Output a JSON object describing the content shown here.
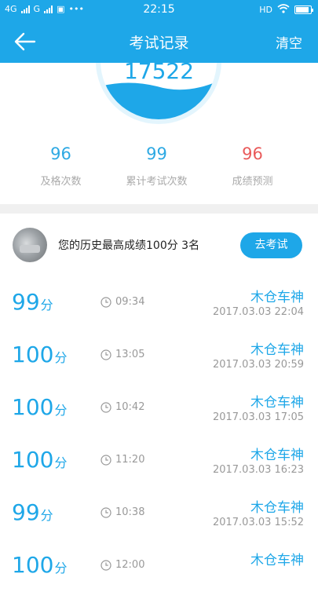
{
  "status_bar": {
    "left_text_1": "4G",
    "left_text_2": "G",
    "dots": "•••",
    "time": "22:15",
    "hd": "HD"
  },
  "app_bar": {
    "title": "考试记录",
    "clear_label": "清空"
  },
  "summary": {
    "total_score": "17522",
    "stats": [
      {
        "value": "96",
        "label": "及格次数"
      },
      {
        "value": "99",
        "label": "累计考试次数"
      },
      {
        "value": "96",
        "label": "成绩预测"
      }
    ]
  },
  "history": {
    "best_text": "您的历史最高成绩100分  3名",
    "button_label": "去考试"
  },
  "records": [
    {
      "score": "99",
      "unit": "分",
      "duration": "09:34",
      "user": "木仓车神",
      "datetime": "2017.03.03   22:04"
    },
    {
      "score": "100",
      "unit": "分",
      "duration": "13:05",
      "user": "木仓车神",
      "datetime": "2017.03.03   20:59"
    },
    {
      "score": "100",
      "unit": "分",
      "duration": "10:42",
      "user": "木仓车神",
      "datetime": "2017.03.03   17:05"
    },
    {
      "score": "100",
      "unit": "分",
      "duration": "11:20",
      "user": "木仓车神",
      "datetime": "2017.03.03   16:23"
    },
    {
      "score": "99",
      "unit": "分",
      "duration": "10:38",
      "user": "木仓车神",
      "datetime": "2017.03.03   15:52"
    },
    {
      "score": "100",
      "unit": "分",
      "duration": "12:00",
      "user": "木仓车神",
      "datetime": ""
    }
  ],
  "colors": {
    "primary": "#1ea7e8",
    "prediction": "#e95a5a"
  }
}
